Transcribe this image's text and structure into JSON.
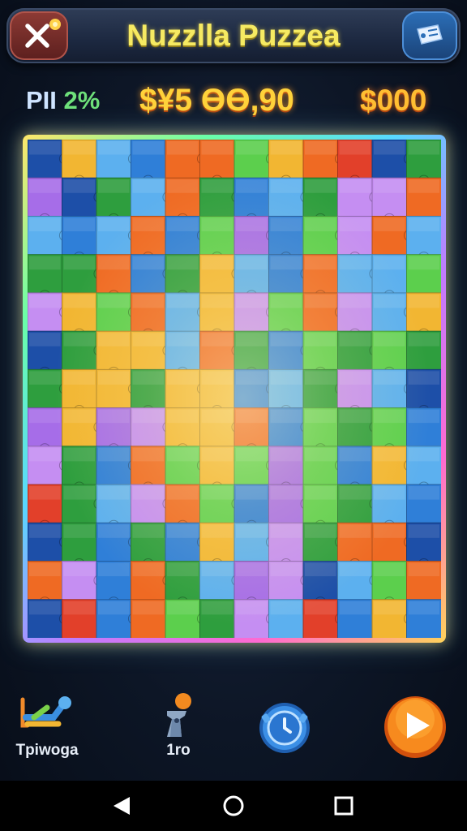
{
  "header": {
    "title": "Nuzzlla Puzzea",
    "close_icon": "close-x-icon",
    "ticket_icon": "ticket-icon"
  },
  "stats": {
    "progress_prefix": "PII",
    "progress_value": "2%",
    "score": "$¥5 ӨӨ,90",
    "coins": "$000"
  },
  "board": {
    "columns": 12,
    "rows": 13,
    "palette": {
      "O": "#ef6a23",
      "Y": "#f2b632",
      "G": "#2e9e3e",
      "L": "#5ccf4d",
      "B": "#2f7fd8",
      "C": "#5cb0ef",
      "P": "#a66de8",
      "V": "#c58ef2",
      "R": "#e2402a",
      "D": "#1d4fa8"
    },
    "grid": [
      "DYCBOOLYORDG",
      "PDGCOGBCGVVO",
      "CBCOBLPBLVOC",
      "GGOBGYCBOCCL",
      "VYLOCYVLOVCY",
      "DGYYCOGBLGLG",
      "GYYGYYBCGVCD",
      "PYPVYYOBLGLB",
      "VGBOLYLPLBYC",
      "RGCVOLBPLGCB",
      "DGBGBYCVGOOD",
      "OVBOGCPVDCLO",
      "DRBOLGVCRBYB"
    ]
  },
  "tools": {
    "shuffle_label": "Tpiwoga",
    "shuffle_icon": "shuffle-seat-icon",
    "hint_label": "1ro",
    "hint_icon": "hint-figure-icon",
    "timer_icon": "timer-clock-icon",
    "play_icon": "play-icon"
  },
  "system_nav": {
    "back_icon": "back-triangle-icon",
    "home_icon": "home-circle-icon",
    "recent_icon": "recent-square-icon"
  }
}
